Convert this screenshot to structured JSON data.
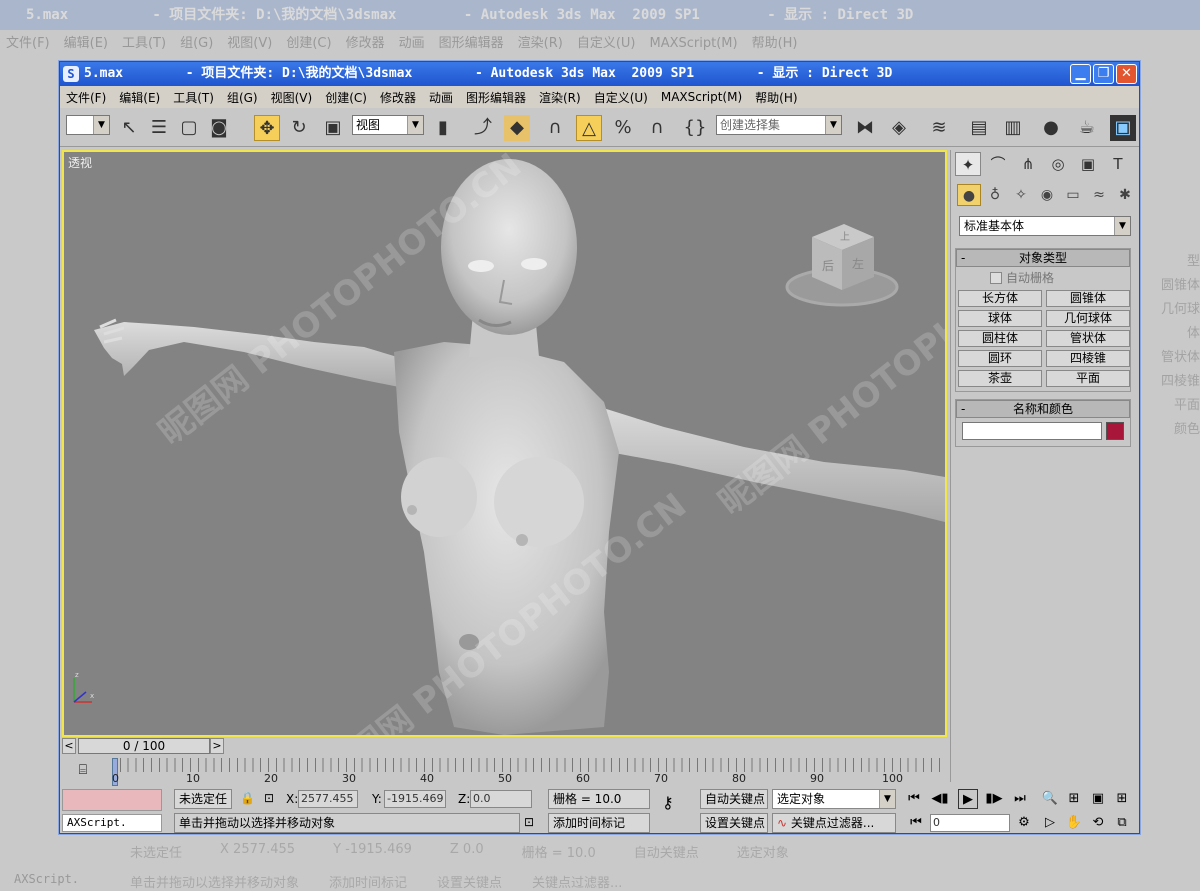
{
  "background": {
    "title": "5.max          - 项目文件夹: D:\\我的文档\\3dsmax        - Autodesk 3ds Max  2009 SP1        - 显示 : Direct 3D",
    "menu": [
      "文件(F)",
      "编辑(E)",
      "工具(T)",
      "组(G)",
      "视图(V)",
      "创建(C)",
      "修改器",
      "动画",
      "图形编辑器",
      "渲染(R)",
      "自定义(U)",
      "MAXScript(M)",
      "帮助(H)"
    ],
    "status1": [
      "未选定任",
      "X 2577.455",
      "Y -1915.469",
      "Z 0.0",
      "栅格 = 10.0",
      "自动关键点",
      "选定对象"
    ],
    "status2": [
      "单击并拖动以选择并移动对象",
      "添加时间标记",
      "设置关键点",
      "关键点过滤器..."
    ],
    "cmd": "AXScript.",
    "right": [
      "型",
      "圆锥体",
      "几何球体",
      "管状体",
      "四棱锥",
      "平面",
      "颜色"
    ]
  },
  "window": {
    "file": "5.max",
    "title": "        - 项目文件夹: D:\\我的文档\\3dsmax        - Autodesk 3ds Max  2009 SP1        - 显示 : Direct 3D"
  },
  "menu": [
    "文件(F)",
    "编辑(E)",
    "工具(T)",
    "组(G)",
    "视图(V)",
    "创建(C)",
    "修改器",
    "动画",
    "图形编辑器",
    "渲染(R)",
    "自定义(U)",
    "MAXScript(M)",
    "帮助(H)"
  ],
  "toolbar": {
    "ref_coord": "视图",
    "selection_set": "创建选择集"
  },
  "viewport": {
    "label": "透视",
    "watermark": "昵图网 PHOTOPHOTO.CN",
    "cube_labels": [
      "上",
      "后",
      "左"
    ]
  },
  "command_panel": {
    "category": "标准基本体",
    "object_type_title": "对象类型",
    "auto_grid": "自动栅格",
    "primitives": [
      "长方体",
      "圆锥体",
      "球体",
      "几何球体",
      "圆柱体",
      "管状体",
      "圆环",
      "四棱锥",
      "茶壶",
      "平面"
    ],
    "name_color_title": "名称和颜色",
    "object_name": "",
    "object_color": "#a8163a"
  },
  "timeline": {
    "frame": "0 / 100",
    "ticks": [
      "0",
      "10",
      "20",
      "30",
      "40",
      "50",
      "60",
      "70",
      "80",
      "90",
      "100"
    ]
  },
  "status": {
    "selection": "未选定任",
    "x_label": "X:",
    "x": "2577.455",
    "y_label": "Y:",
    "y": "-1915.469",
    "z_label": "Z:",
    "z": "0.0",
    "grid": "栅格 = 10.0",
    "auto_key": "自动关键点",
    "selected_object": "选定对象",
    "set_key": "设置关键点",
    "key_filters": "关键点过滤器...",
    "prompt": "单击并拖动以选择并移动对象",
    "add_time_tag": "添加时间标记",
    "maxscript": "AXScript.",
    "frame_field": "0"
  }
}
